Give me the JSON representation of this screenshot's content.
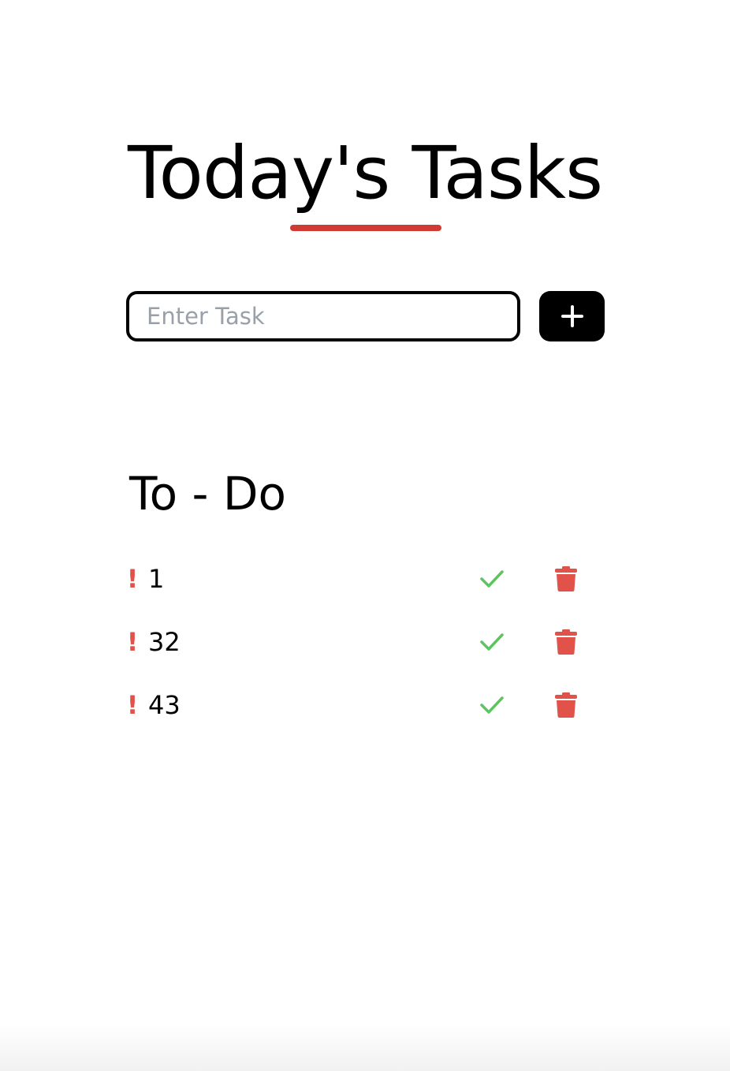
{
  "header": {
    "title": "Today's Tasks"
  },
  "task_form": {
    "input_value": "",
    "input_placeholder": "Enter Task",
    "add_button_icon": "plus-icon"
  },
  "todo_section": {
    "title": "To - Do",
    "tasks": [
      {
        "text": "1",
        "priority_icon": "!",
        "complete_icon": "check-icon",
        "delete_icon": "trash-icon"
      },
      {
        "text": "32",
        "priority_icon": "!",
        "complete_icon": "check-icon",
        "delete_icon": "trash-icon"
      },
      {
        "text": "43",
        "priority_icon": "!",
        "complete_icon": "check-icon",
        "delete_icon": "trash-icon"
      }
    ]
  },
  "colors": {
    "accent_red": "#cf3a33",
    "priority_red": "#e0524a",
    "check_green": "#5cc460",
    "button_black": "#000000",
    "placeholder_gray": "#9aa0a8"
  }
}
